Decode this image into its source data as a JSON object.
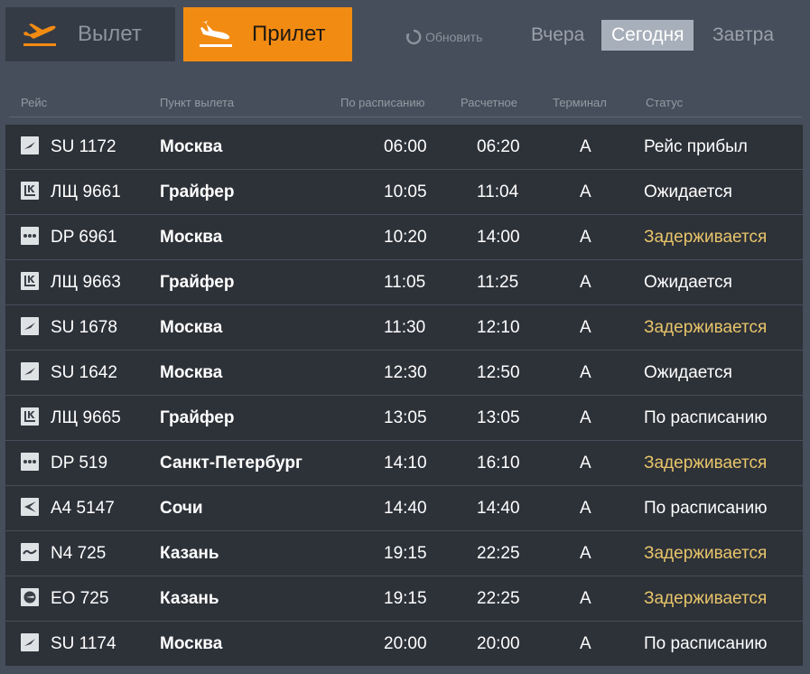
{
  "tabs": {
    "departure": {
      "label": "Вылет",
      "icon": "plane-departure-icon"
    },
    "arrival": {
      "label": "Прилет",
      "icon": "plane-arrival-icon"
    }
  },
  "refresh": {
    "label": "Обновить",
    "icon": "refresh-icon"
  },
  "days": {
    "yesterday": "Вчера",
    "today": "Сегодня",
    "tomorrow": "Завтра",
    "selected": "today"
  },
  "columns": {
    "flight": "Рейс",
    "from": "Пункт вылета",
    "scheduled": "По расписанию",
    "estimated": "Расчетное",
    "terminal": "Терминал",
    "status": "Статус"
  },
  "colors": {
    "accent": "#f28b12",
    "delayed": "#e8c56a",
    "row_bg": "#2d3138",
    "page_bg": "#454e5a"
  },
  "flights": [
    {
      "logo": "aeroflot-logo-icon",
      "flight": "SU 1172",
      "from": "Москва",
      "scheduled": "06:00",
      "estimated": "06:20",
      "terminal": "A",
      "status": "Рейс прибыл",
      "status_type": "arrived"
    },
    {
      "logo": "lukoil-logo-icon",
      "flight": "ЛЩ 9661",
      "from": "Грайфер",
      "scheduled": "10:05",
      "estimated": "11:04",
      "terminal": "A",
      "status": "Ожидается",
      "status_type": "expected"
    },
    {
      "logo": "pobeda-logo-icon",
      "flight": "DP 6961",
      "from": "Москва",
      "scheduled": "10:20",
      "estimated": "14:00",
      "terminal": "A",
      "status": "Задерживается",
      "status_type": "delayed"
    },
    {
      "logo": "lukoil-logo-icon",
      "flight": "ЛЩ 9663",
      "from": "Грайфер",
      "scheduled": "11:05",
      "estimated": "11:25",
      "terminal": "A",
      "status": "Ожидается",
      "status_type": "expected"
    },
    {
      "logo": "aeroflot-logo-icon",
      "flight": "SU 1678",
      "from": "Москва",
      "scheduled": "11:30",
      "estimated": "12:10",
      "terminal": "A",
      "status": "Задерживается",
      "status_type": "delayed"
    },
    {
      "logo": "aeroflot-logo-icon",
      "flight": "SU 1642",
      "from": "Москва",
      "scheduled": "12:30",
      "estimated": "12:50",
      "terminal": "A",
      "status": "Ожидается",
      "status_type": "expected"
    },
    {
      "logo": "lukoil-logo-icon",
      "flight": "ЛЩ 9665",
      "from": "Грайфер",
      "scheduled": "13:05",
      "estimated": "13:05",
      "terminal": "A",
      "status": "По расписанию",
      "status_type": "scheduled"
    },
    {
      "logo": "pobeda-logo-icon",
      "flight": "DP 519",
      "from": "Санкт-Петербург",
      "scheduled": "14:10",
      "estimated": "16:10",
      "terminal": "A",
      "status": "Задерживается",
      "status_type": "delayed"
    },
    {
      "logo": "alrosa-logo-icon",
      "flight": "A4 5147",
      "from": "Сочи",
      "scheduled": "14:40",
      "estimated": "14:40",
      "terminal": "A",
      "status": "По расписанию",
      "status_type": "scheduled"
    },
    {
      "logo": "nordwind-logo-icon",
      "flight": "N4 725",
      "from": "Казань",
      "scheduled": "19:15",
      "estimated": "22:25",
      "terminal": "A",
      "status": "Задерживается",
      "status_type": "delayed"
    },
    {
      "logo": "ikar-logo-icon",
      "flight": "EO 725",
      "from": "Казань",
      "scheduled": "19:15",
      "estimated": "22:25",
      "terminal": "A",
      "status": "Задерживается",
      "status_type": "delayed"
    },
    {
      "logo": "aeroflot-logo-icon",
      "flight": "SU 1174",
      "from": "Москва",
      "scheduled": "20:00",
      "estimated": "20:00",
      "terminal": "A",
      "status": "По расписанию",
      "status_type": "scheduled"
    }
  ]
}
